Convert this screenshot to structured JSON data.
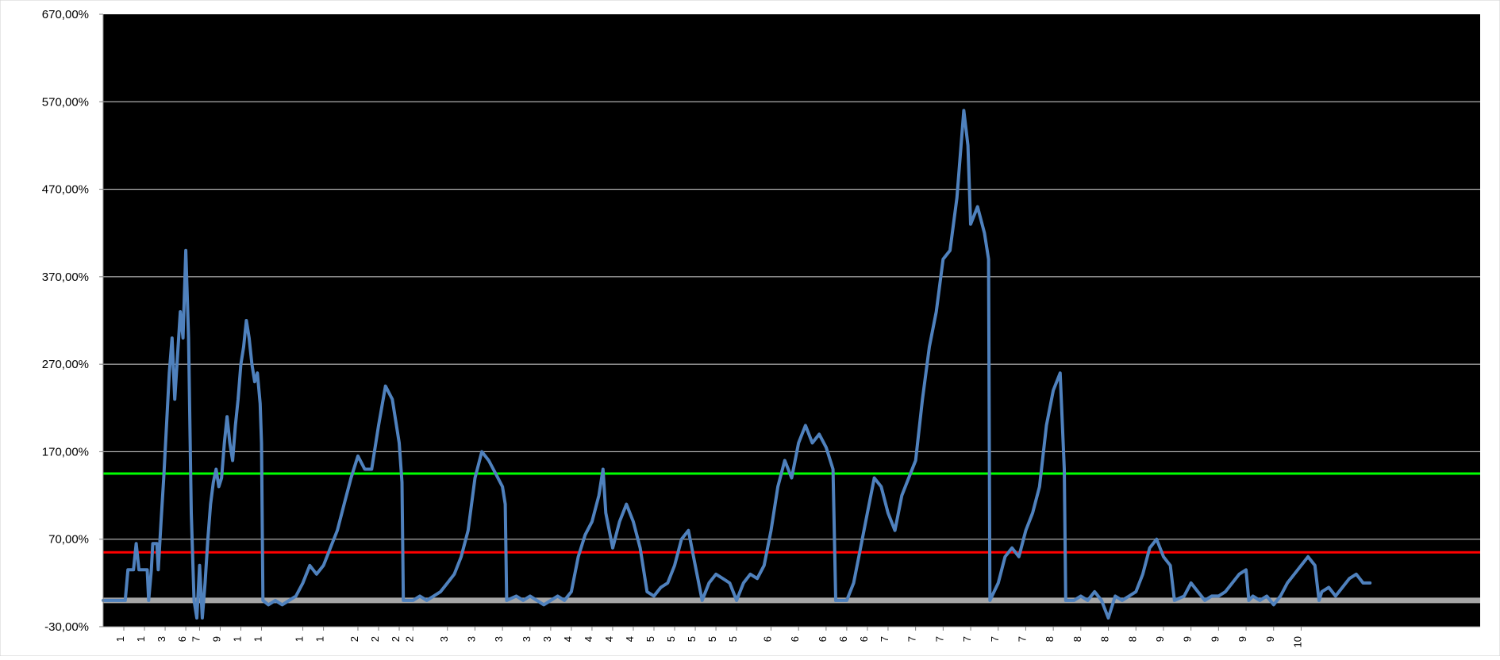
{
  "chart_data": {
    "type": "line",
    "title": "",
    "xlabel": "",
    "ylabel": "",
    "ylim": [
      -30,
      670
    ],
    "xlim": [
      0,
      100
    ],
    "grid": true,
    "y_ticks": [
      "670,00%",
      "570,00%",
      "470,00%",
      "370,00%",
      "270,00%",
      "170,00%",
      "70,00%",
      "-30,00%"
    ],
    "y_tick_values": [
      670,
      570,
      470,
      370,
      270,
      170,
      70,
      -30
    ],
    "x_tick_labels": [
      "1",
      "1",
      "3",
      "6",
      "7",
      "9",
      "1",
      "1",
      "1",
      "1",
      "2",
      "2",
      "2",
      "2",
      "3",
      "3",
      "3",
      "3",
      "3",
      "4",
      "4",
      "4",
      "4",
      "5",
      "5",
      "5",
      "5",
      "5",
      "6",
      "6",
      "6",
      "6",
      "6",
      "7",
      "7",
      "7",
      "7",
      "7",
      "7",
      "8",
      "8",
      "8",
      "8",
      "9",
      "9",
      "9",
      "9",
      "9",
      "10"
    ],
    "x_tick_positions": [
      1.5,
      3.0,
      4.5,
      6.0,
      7.0,
      8.5,
      10.0,
      11.5,
      14.5,
      16.0,
      18.5,
      20.0,
      21.5,
      22.5,
      25.0,
      27.0,
      29.0,
      31.0,
      32.5,
      34.0,
      35.5,
      37.0,
      38.5,
      40.0,
      41.5,
      43.0,
      44.5,
      46.0,
      48.5,
      50.5,
      52.5,
      54.0,
      55.5,
      57.0,
      59.0,
      61.0,
      63.0,
      65.0,
      67.0,
      69.0,
      71.0,
      73.0,
      75.0,
      77.0,
      79.0,
      81.0,
      83.0,
      85.0,
      87.0
    ],
    "colors": {
      "plot_background": "#000000",
      "series": "#4f81bd",
      "line_upper": "#00ff00",
      "line_lower": "#ff0000",
      "line_zero": "#a6a6a6",
      "grid": "#d9d9d9",
      "axis_text": "#000000"
    },
    "series": [
      {
        "values": [
          [
            0,
            0
          ],
          [
            1.6,
            0
          ],
          [
            1.8,
            35
          ],
          [
            2.2,
            35
          ],
          [
            2.4,
            65
          ],
          [
            2.6,
            35
          ],
          [
            3.2,
            35
          ],
          [
            3.3,
            0
          ],
          [
            3.5,
            35
          ],
          [
            3.6,
            65
          ],
          [
            3.9,
            65
          ],
          [
            4.0,
            35
          ],
          [
            4.2,
            90
          ],
          [
            4.4,
            140
          ],
          [
            4.6,
            200
          ],
          [
            4.8,
            260
          ],
          [
            5.0,
            300
          ],
          [
            5.2,
            230
          ],
          [
            5.4,
            280
          ],
          [
            5.6,
            330
          ],
          [
            5.8,
            300
          ],
          [
            6.0,
            400
          ],
          [
            6.2,
            300
          ],
          [
            6.4,
            100
          ],
          [
            6.6,
            0
          ],
          [
            6.8,
            -20
          ],
          [
            7.0,
            40
          ],
          [
            7.2,
            -20
          ],
          [
            7.4,
            20
          ],
          [
            7.6,
            70
          ],
          [
            7.8,
            110
          ],
          [
            8.0,
            135
          ],
          [
            8.2,
            150
          ],
          [
            8.4,
            130
          ],
          [
            8.6,
            140
          ],
          [
            8.8,
            180
          ],
          [
            9.0,
            210
          ],
          [
            9.2,
            180
          ],
          [
            9.4,
            160
          ],
          [
            9.6,
            200
          ],
          [
            9.8,
            230
          ],
          [
            10.0,
            270
          ],
          [
            10.2,
            290
          ],
          [
            10.4,
            320
          ],
          [
            10.6,
            300
          ],
          [
            10.8,
            270
          ],
          [
            11.0,
            250
          ],
          [
            11.2,
            260
          ],
          [
            11.4,
            225
          ],
          [
            11.5,
            180
          ],
          [
            11.6,
            0
          ],
          [
            12.0,
            -5
          ],
          [
            12.5,
            0
          ],
          [
            13.0,
            -5
          ],
          [
            13.5,
            0
          ],
          [
            14.0,
            5
          ],
          [
            14.5,
            20
          ],
          [
            15.0,
            40
          ],
          [
            15.5,
            30
          ],
          [
            16.0,
            40
          ],
          [
            16.5,
            60
          ],
          [
            17.0,
            80
          ],
          [
            17.5,
            110
          ],
          [
            18.0,
            140
          ],
          [
            18.5,
            165
          ],
          [
            19.0,
            150
          ],
          [
            19.5,
            150
          ],
          [
            20.0,
            200
          ],
          [
            20.5,
            245
          ],
          [
            21.0,
            230
          ],
          [
            21.5,
            180
          ],
          [
            21.7,
            135
          ],
          [
            21.8,
            0
          ],
          [
            22.5,
            0
          ],
          [
            23.0,
            5
          ],
          [
            23.5,
            0
          ],
          [
            24.0,
            5
          ],
          [
            24.5,
            10
          ],
          [
            25.0,
            20
          ],
          [
            25.5,
            30
          ],
          [
            26.0,
            50
          ],
          [
            26.5,
            80
          ],
          [
            27.0,
            140
          ],
          [
            27.5,
            170
          ],
          [
            28.0,
            160
          ],
          [
            28.5,
            145
          ],
          [
            29.0,
            130
          ],
          [
            29.2,
            110
          ],
          [
            29.3,
            0
          ],
          [
            30.0,
            5
          ],
          [
            30.5,
            0
          ],
          [
            31.0,
            5
          ],
          [
            31.5,
            0
          ],
          [
            32.0,
            -5
          ],
          [
            32.5,
            0
          ],
          [
            33.0,
            5
          ],
          [
            33.5,
            0
          ],
          [
            34.0,
            10
          ],
          [
            34.5,
            50
          ],
          [
            35.0,
            75
          ],
          [
            35.5,
            90
          ],
          [
            36.0,
            120
          ],
          [
            36.3,
            150
          ],
          [
            36.5,
            100
          ],
          [
            37.0,
            60
          ],
          [
            37.5,
            90
          ],
          [
            38.0,
            110
          ],
          [
            38.5,
            90
          ],
          [
            39.0,
            60
          ],
          [
            39.5,
            10
          ],
          [
            40.0,
            5
          ],
          [
            40.5,
            15
          ],
          [
            41.0,
            20
          ],
          [
            41.5,
            40
          ],
          [
            42.0,
            70
          ],
          [
            42.5,
            80
          ],
          [
            43.0,
            40
          ],
          [
            43.5,
            0
          ],
          [
            44.0,
            20
          ],
          [
            44.5,
            30
          ],
          [
            45.0,
            25
          ],
          [
            45.5,
            20
          ],
          [
            46.0,
            0
          ],
          [
            46.5,
            20
          ],
          [
            47.0,
            30
          ],
          [
            47.5,
            25
          ],
          [
            48.0,
            40
          ],
          [
            48.5,
            80
          ],
          [
            49.0,
            130
          ],
          [
            49.5,
            160
          ],
          [
            50.0,
            140
          ],
          [
            50.5,
            180
          ],
          [
            51.0,
            200
          ],
          [
            51.5,
            180
          ],
          [
            52.0,
            190
          ],
          [
            52.5,
            175
          ],
          [
            53.0,
            150
          ],
          [
            53.2,
            0
          ],
          [
            54.0,
            0
          ],
          [
            54.5,
            20
          ],
          [
            55.0,
            60
          ],
          [
            55.5,
            100
          ],
          [
            56.0,
            140
          ],
          [
            56.5,
            130
          ],
          [
            57.0,
            100
          ],
          [
            57.5,
            80
          ],
          [
            58.0,
            120
          ],
          [
            58.5,
            140
          ],
          [
            59.0,
            160
          ],
          [
            59.5,
            230
          ],
          [
            60.0,
            290
          ],
          [
            60.5,
            330
          ],
          [
            61.0,
            390
          ],
          [
            61.5,
            400
          ],
          [
            62.0,
            460
          ],
          [
            62.5,
            560
          ],
          [
            62.8,
            520
          ],
          [
            63.0,
            430
          ],
          [
            63.5,
            450
          ],
          [
            64.0,
            420
          ],
          [
            64.3,
            390
          ],
          [
            64.4,
            0
          ],
          [
            65.0,
            20
          ],
          [
            65.5,
            50
          ],
          [
            66.0,
            60
          ],
          [
            66.5,
            50
          ],
          [
            67.0,
            80
          ],
          [
            67.5,
            100
          ],
          [
            68.0,
            130
          ],
          [
            68.5,
            200
          ],
          [
            69.0,
            240
          ],
          [
            69.5,
            260
          ],
          [
            69.8,
            150
          ],
          [
            69.9,
            0
          ],
          [
            70.5,
            0
          ],
          [
            71.0,
            5
          ],
          [
            71.5,
            0
          ],
          [
            72.0,
            10
          ],
          [
            72.5,
            0
          ],
          [
            73.0,
            -20
          ],
          [
            73.5,
            5
          ],
          [
            74.0,
            0
          ],
          [
            74.5,
            5
          ],
          [
            75.0,
            10
          ],
          [
            75.5,
            30
          ],
          [
            76.0,
            60
          ],
          [
            76.5,
            70
          ],
          [
            77.0,
            50
          ],
          [
            77.5,
            40
          ],
          [
            77.8,
            0
          ],
          [
            78.5,
            5
          ],
          [
            79.0,
            20
          ],
          [
            79.5,
            10
          ],
          [
            80.0,
            0
          ],
          [
            80.5,
            5
          ],
          [
            81.0,
            5
          ],
          [
            81.5,
            10
          ],
          [
            82.0,
            20
          ],
          [
            82.5,
            30
          ],
          [
            83.0,
            35
          ],
          [
            83.2,
            0
          ],
          [
            83.5,
            5
          ],
          [
            84.0,
            0
          ],
          [
            84.5,
            5
          ],
          [
            85.0,
            -5
          ],
          [
            85.5,
            5
          ],
          [
            86.0,
            20
          ],
          [
            86.5,
            30
          ],
          [
            87.0,
            40
          ],
          [
            87.5,
            50
          ],
          [
            88.0,
            40
          ],
          [
            88.3,
            0
          ],
          [
            88.5,
            10
          ],
          [
            89.0,
            15
          ],
          [
            89.5,
            5
          ],
          [
            90.0,
            15
          ],
          [
            90.5,
            25
          ],
          [
            91.0,
            30
          ],
          [
            91.5,
            20
          ],
          [
            92.0,
            20
          ]
        ]
      }
    ],
    "reference_lines": [
      {
        "name": "upper-threshold",
        "value": 145,
        "color": "#00ff00"
      },
      {
        "name": "lower-threshold",
        "value": 55,
        "color": "#ff0000"
      },
      {
        "name": "zero-baseline",
        "value": 0,
        "color": "#a6a6a6"
      }
    ]
  }
}
